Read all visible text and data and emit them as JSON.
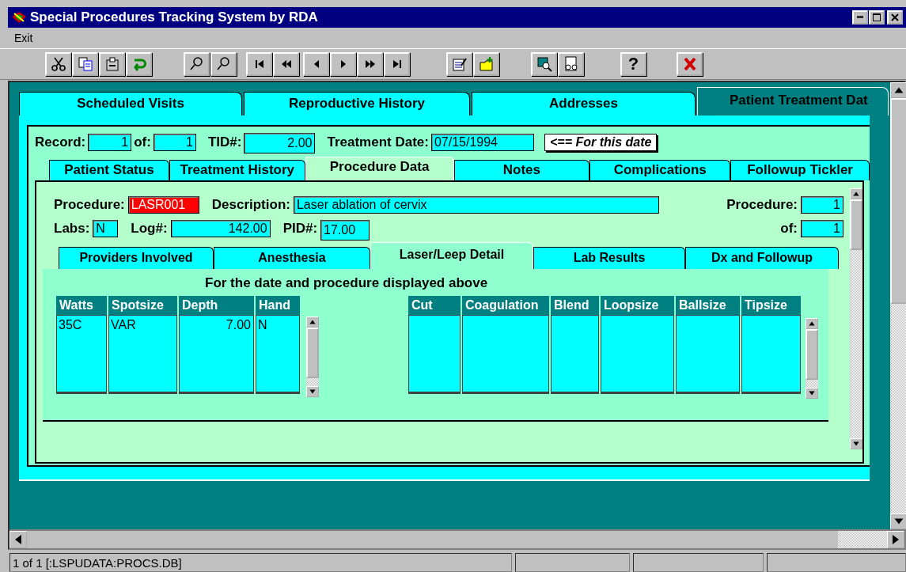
{
  "window": {
    "title": "Special Procedures Tracking System by RDA"
  },
  "menu": [
    {
      "label": "Exit"
    }
  ],
  "toolbar": {
    "help_label": "?"
  },
  "main_tabs": [
    {
      "label": "Scheduled Visits",
      "selected": false
    },
    {
      "label": "Reproductive History",
      "selected": false
    },
    {
      "label": "Addresses",
      "selected": false
    },
    {
      "label": "Patient Treatment Dat",
      "selected": true
    }
  ],
  "record": {
    "record_label": "Record:",
    "record": "1",
    "of_label": "of:",
    "of": "1",
    "tid_label": "TID#:",
    "tid": "2.00",
    "date_label": "Treatment Date:",
    "date": "07/15/1994",
    "note": "<== For this date"
  },
  "treatment_tabs": [
    {
      "label": "Patient Status",
      "selected": false
    },
    {
      "label": "Treatment History",
      "selected": false
    },
    {
      "label": "Procedure Data",
      "selected": true
    },
    {
      "label": "Notes",
      "selected": false
    },
    {
      "label": "Complications",
      "selected": false
    },
    {
      "label": "Followup Tickler",
      "selected": false
    }
  ],
  "procedure": {
    "procedure_label": "Procedure:",
    "procedure": "LASR001",
    "procedure_highlighted": true,
    "description_label": "Description:",
    "description": "Laser ablation of cervix",
    "labs_label": "Labs:",
    "labs": "N",
    "log_label": "Log#:",
    "log": "142.00",
    "pid_label": "PID#:",
    "pid": "17.00",
    "count_label": "Procedure:",
    "count": "1",
    "total_label": "of:",
    "total": "1"
  },
  "detail_tabs": [
    {
      "label": "Providers Involved",
      "selected": false
    },
    {
      "label": "Anesthesia",
      "selected": false
    },
    {
      "label": "Laser/Leep Detail",
      "selected": true
    },
    {
      "label": "Lab Results",
      "selected": false
    },
    {
      "label": "Dx and Followup",
      "selected": false
    }
  ],
  "detail": {
    "heading": "For the date and procedure displayed above",
    "laser_table": {
      "columns": [
        {
          "label": "Watts",
          "kind": "text"
        },
        {
          "label": "Spotsize",
          "kind": "text"
        },
        {
          "label": "Depth",
          "kind": "number"
        },
        {
          "label": "Hand",
          "kind": "text"
        }
      ],
      "rows": [
        [
          "35C",
          "VAR",
          "7.00",
          "N"
        ]
      ]
    },
    "leep_table": {
      "columns": [
        {
          "label": "Cut"
        },
        {
          "label": "Coagulation"
        },
        {
          "label": "Blend"
        },
        {
          "label": "Loopsize"
        },
        {
          "label": "Ballsize"
        },
        {
          "label": "Tipsize"
        }
      ]
    }
  },
  "status_bar": [
    {
      "text": "1 of 1 [:LSPUDATA:PROCS.DB]"
    }
  ]
}
